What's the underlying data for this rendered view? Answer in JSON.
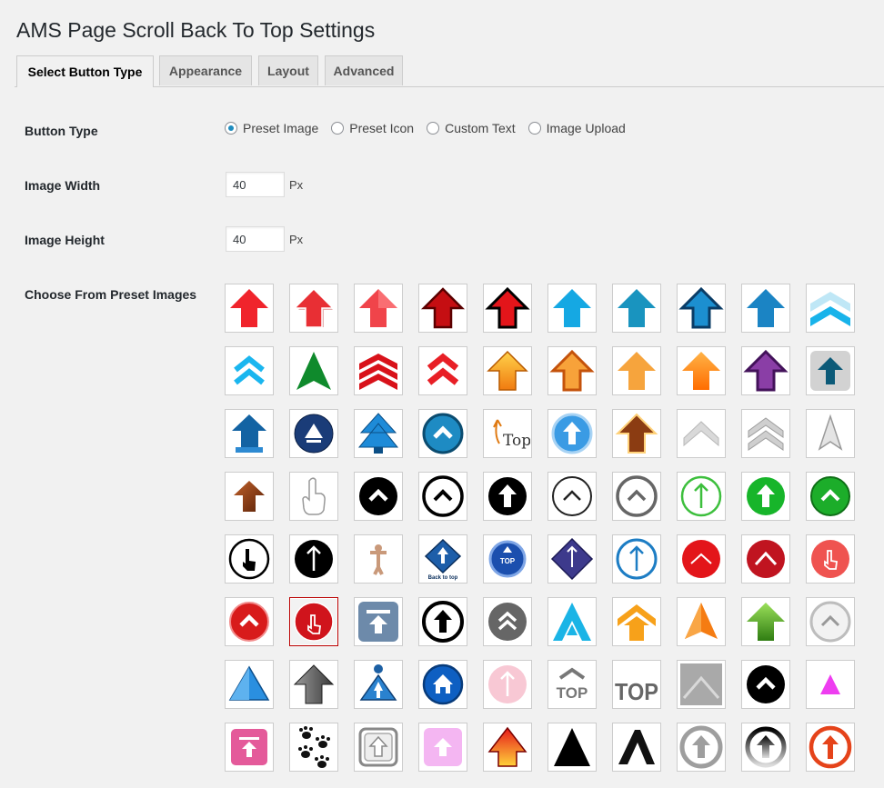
{
  "page": {
    "title": "AMS Page Scroll Back To Top Settings"
  },
  "tabs": [
    {
      "label": "Select Button Type",
      "active": true
    },
    {
      "label": "Appearance",
      "active": false
    },
    {
      "label": "Layout",
      "active": false
    },
    {
      "label": "Advanced",
      "active": false
    }
  ],
  "form": {
    "button_type": {
      "label": "Button Type",
      "options": [
        "Preset Image",
        "Preset Icon",
        "Custom Text",
        "Image Upload"
      ],
      "selected": "Preset Image"
    },
    "image_width": {
      "label": "Image Width",
      "value": "40",
      "unit": "Px"
    },
    "image_height": {
      "label": "Image Height",
      "value": "40",
      "unit": "Px"
    },
    "preset_images": {
      "label": "Choose From Preset Images",
      "selected_index": 51,
      "items": [
        {
          "name": "red-arrow-icon"
        },
        {
          "name": "red-arrow-shadow-icon"
        },
        {
          "name": "red-glossy-arrow-icon"
        },
        {
          "name": "dark-red-arrow-icon"
        },
        {
          "name": "red-black-outline-arrow-icon"
        },
        {
          "name": "sky-blue-arrow-icon"
        },
        {
          "name": "teal-arrow-icon"
        },
        {
          "name": "blue-outline-arrow-icon"
        },
        {
          "name": "blue-arrow-icon"
        },
        {
          "name": "light-blue-chevron-icon"
        },
        {
          "name": "blue-double-chevron-icon"
        },
        {
          "name": "green-triangle-icon"
        },
        {
          "name": "red-triple-chevron-icon"
        },
        {
          "name": "red-double-chevron-icon"
        },
        {
          "name": "orange-gradient-arrow-icon"
        },
        {
          "name": "orange-outline-arrow-icon"
        },
        {
          "name": "light-orange-arrow-icon"
        },
        {
          "name": "orange-arrow-icon"
        },
        {
          "name": "purple-arrow-icon"
        },
        {
          "name": "teal-square-arrow-icon"
        },
        {
          "name": "blue-scroll-arrow-icon"
        },
        {
          "name": "navy-circle-triangle-icon"
        },
        {
          "name": "blue-tree-arrow-icon"
        },
        {
          "name": "blue-circle-chevron-icon"
        },
        {
          "name": "orange-top-text-icon"
        },
        {
          "name": "blue-circle-arrow-icon"
        },
        {
          "name": "bulb-arrow-icon"
        },
        {
          "name": "gray-chevron-icon"
        },
        {
          "name": "gray-double-chevron-icon"
        },
        {
          "name": "gray-pointer-icon"
        },
        {
          "name": "wood-arrow-icon"
        },
        {
          "name": "hand-pointer-icon"
        },
        {
          "name": "black-circle-chevron-icon"
        },
        {
          "name": "outline-circle-chevron-icon"
        },
        {
          "name": "black-circle-arrow-icon"
        },
        {
          "name": "thin-circle-chevron-icon"
        },
        {
          "name": "gray-circle-chevron-icon"
        },
        {
          "name": "green-outline-circle-arrow-icon"
        },
        {
          "name": "green-circle-arrow-icon"
        },
        {
          "name": "green-circle-chevron-icon"
        },
        {
          "name": "hand-circle-icon"
        },
        {
          "name": "black-circle-thin-arrow-icon"
        },
        {
          "name": "figure-icon"
        },
        {
          "name": "blue-diamond-back-to-top-icon"
        },
        {
          "name": "blue-circle-top-icon"
        },
        {
          "name": "purple-diamond-arrow-icon"
        },
        {
          "name": "blue-outline-circle-arrow-icon"
        },
        {
          "name": "red-circle-chevron-icon"
        },
        {
          "name": "dark-red-circle-chevron-icon"
        },
        {
          "name": "red-circle-hand-icon"
        },
        {
          "name": "red-button-chevron-icon"
        },
        {
          "name": "red-hand-tap-icon"
        },
        {
          "name": "slate-top-bar-icon"
        },
        {
          "name": "black-ring-arrow-icon"
        },
        {
          "name": "gray-circle-double-chevron-icon"
        },
        {
          "name": "blue-a-arrow-icon"
        },
        {
          "name": "orange-house-arrow-icon"
        },
        {
          "name": "orange-triangle-icon"
        },
        {
          "name": "green-grass-arrow-icon"
        },
        {
          "name": "silver-circle-chevron-icon"
        },
        {
          "name": "blue-pyramid-icon"
        },
        {
          "name": "gray-3d-arrow-icon"
        },
        {
          "name": "blue-person-arrow-icon"
        },
        {
          "name": "blue-circle-home-icon"
        },
        {
          "name": "pink-circle-arrow-icon"
        },
        {
          "name": "gray-top-text-icon"
        },
        {
          "name": "gray-top-big-text-icon"
        },
        {
          "name": "gray-square-triangle-icon"
        },
        {
          "name": "black-circle-chevron-2-icon"
        },
        {
          "name": "magenta-triangle-icon"
        },
        {
          "name": "pink-square-top-icon"
        },
        {
          "name": "paw-prints-icon"
        },
        {
          "name": "gray-square-arrow-icon"
        },
        {
          "name": "pink-square-arrow-icon"
        },
        {
          "name": "red-yellow-arrow-icon"
        },
        {
          "name": "black-triangle-icon"
        },
        {
          "name": "black-brush-chevron-icon"
        },
        {
          "name": "gray-ring-arrow-icon"
        },
        {
          "name": "black-gradient-ring-arrow-icon"
        },
        {
          "name": "orange-ring-arrow-icon"
        }
      ]
    }
  }
}
